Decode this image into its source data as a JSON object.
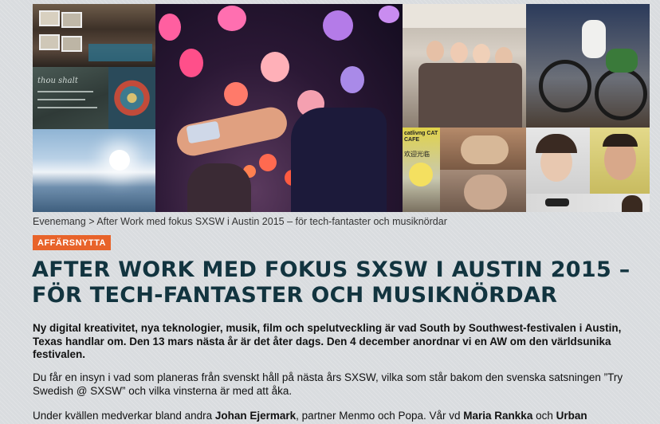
{
  "breadcrumb": {
    "root": "Evenemang",
    "separator": ">",
    "current": "After Work med fokus SXSW i Austin 2015 – för tech-fantaster och musiknördar"
  },
  "category_tag": "AFFÄRSNYTTA",
  "headline": "AFTER WORK MED FOKUS SXSW I AUSTIN 2015 – FÖR TECH-FANTASTER OCH MUSIKNÖRDAR",
  "lead": "Ny digital kreativitet, nya teknologier, musik, film och spelutveckling är vad South by Southwest-festivalen i Austin, Texas handlar om. Den 13 mars nästa år är det åter dags. Den 4 december anordnar vi en AW om den världsunika festivalen.",
  "paragraph1": "Du får en insyn i vad som planeras från svenskt håll på nästa års SXSW, vilka som står bakom den svenska satsningen ”Try Swedish @ SXSW” och vilka vinsterna är med att åka.",
  "paragraph2": {
    "t1": "Under kvällen medverkar bland andra ",
    "name1": "Johan Ejermark",
    "t2": ", partner Menmo och Popa. Vår vd ",
    "name2": "Maria Rankka",
    "t3": " och ",
    "name3": "Urban"
  },
  "collage": {
    "sign_text_1": "thou shalt",
    "sign_text_2": "catlivng CAT CAFE",
    "sign_text_3": "欢迎光临"
  },
  "colors": {
    "tag_bg": "#e8632a",
    "headline": "#12343f",
    "page_bg": "#d9dcdf"
  }
}
